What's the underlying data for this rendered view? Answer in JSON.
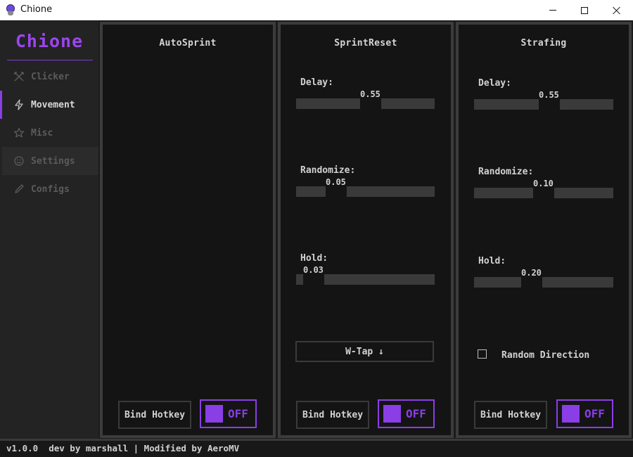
{
  "window": {
    "title": "Chione"
  },
  "sidebar": {
    "brand": "Chione",
    "items": [
      {
        "label": "Clicker",
        "icon": "crossed-swords-icon"
      },
      {
        "label": "Movement",
        "icon": "lightning-icon"
      },
      {
        "label": "Misc",
        "icon": "star-icon"
      },
      {
        "label": "Settings",
        "icon": "smiley-icon"
      },
      {
        "label": "Configs",
        "icon": "pencil-icon"
      }
    ],
    "active_item": "Movement"
  },
  "panels": {
    "autosprint": {
      "title": "AutoSprint",
      "bind_label": "Bind Hotkey",
      "toggle_label": "OFF"
    },
    "sprintreset": {
      "title": "SprintReset",
      "delay_label": "Delay:",
      "delay_value": "0.55",
      "randomize_label": "Randomize:",
      "randomize_value": "0.05",
      "hold_label": "Hold:",
      "hold_value": "0.03",
      "mode_label": "W-Tap ↓",
      "bind_label": "Bind Hotkey",
      "toggle_label": "OFF"
    },
    "strafing": {
      "title": "Strafing",
      "delay_label": "Delay:",
      "delay_value": "0.55",
      "randomize_label": "Randomize:",
      "randomize_value": "0.10",
      "hold_label": "Hold:",
      "hold_value": "0.20",
      "random_direction_label": "Random Direction",
      "random_direction_checked": false,
      "bind_label": "Bind Hotkey",
      "toggle_label": "OFF"
    }
  },
  "status": {
    "text": "v1.0.0  dev by marshall | Modified by AeroMV"
  },
  "colors": {
    "accent": "#8a3ee6",
    "brand": "#9b45ee",
    "background": "#141414",
    "sidebar": "#232323",
    "track": "#3a3a3a"
  }
}
